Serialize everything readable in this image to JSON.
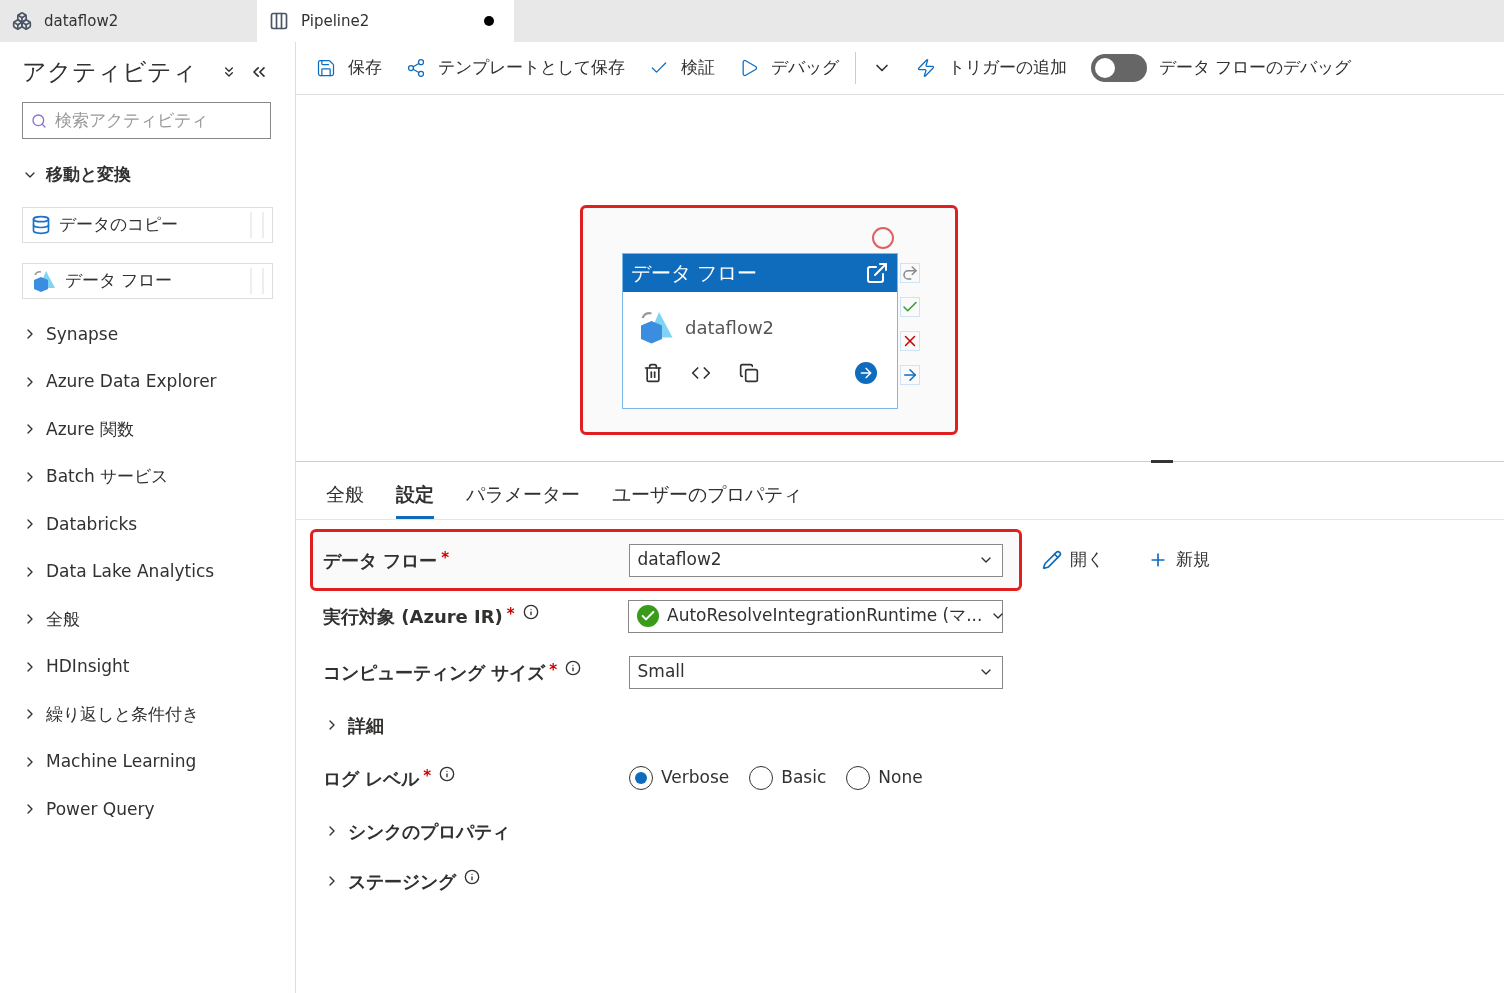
{
  "doc_tabs": [
    {
      "label": "dataflow2",
      "kind": "dataflow",
      "selected": false,
      "modified": false
    },
    {
      "label": "Pipeline2",
      "kind": "pipeline",
      "selected": true,
      "modified": true
    }
  ],
  "sidebar": {
    "title": "アクティビティ",
    "search": {
      "placeholder": "検索アクティビティ"
    },
    "groups": [
      {
        "label": "移動と変換",
        "expanded": true,
        "children": [
          {
            "label": "データのコピー",
            "kind": "copy"
          },
          {
            "label": "データ フロー",
            "kind": "dataflow"
          }
        ]
      },
      {
        "label": "Synapse",
        "expanded": false
      },
      {
        "label": "Azure Data Explorer",
        "expanded": false
      },
      {
        "label": "Azure 関数",
        "expanded": false
      },
      {
        "label": "Batch サービス",
        "expanded": false
      },
      {
        "label": "Databricks",
        "expanded": false
      },
      {
        "label": "Data Lake Analytics",
        "expanded": false
      },
      {
        "label": "全般",
        "expanded": false
      },
      {
        "label": "HDInsight",
        "expanded": false
      },
      {
        "label": "繰り返しと条件付き",
        "expanded": false
      },
      {
        "label": "Machine Learning",
        "expanded": false
      },
      {
        "label": "Power Query",
        "expanded": false
      }
    ]
  },
  "toolbar": {
    "buttons": [
      {
        "label": "保存",
        "kind": "save"
      },
      {
        "label": "テンプレートとして保存",
        "kind": "template"
      },
      {
        "label": "検証",
        "kind": "validate"
      },
      {
        "label": "デバッグ",
        "kind": "debug"
      },
      {
        "label": "トリガーの追加",
        "kind": "trigger"
      }
    ],
    "debug_toggle": {
      "label": "データ フローのデバッグ",
      "on": false
    }
  },
  "activity": {
    "title": "データ フロー",
    "name": "dataflow2",
    "highlighted": true
  },
  "panel_tabs": [
    {
      "label": "全般",
      "selected": false
    },
    {
      "label": "設定",
      "selected": true
    },
    {
      "label": "パラメーター",
      "selected": false
    },
    {
      "label": "ユーザーのプロパティ",
      "selected": false
    }
  ],
  "form": [
    {
      "kind": "dropdown",
      "label": "データ フロー",
      "required_mark": "*",
      "highlighted": true,
      "value": "dataflow2",
      "actions": [
        {
          "label": "開く",
          "kind": "edit"
        },
        {
          "label": "新規",
          "kind": "new"
        }
      ]
    },
    {
      "kind": "dropdown",
      "label": "実行対象 (Azure IR)",
      "required_mark": "*",
      "info": true,
      "value": "AutoResolveIntegrationRuntime (マ...",
      "status_ok": true
    },
    {
      "kind": "dropdown",
      "label": "コンピューティング サイズ",
      "required_mark": "*",
      "info": true,
      "value": "Small"
    },
    {
      "kind": "section",
      "label": "詳細"
    },
    {
      "kind": "radio",
      "label": "ログ レベル",
      "required_mark": "*",
      "info": true,
      "options": [
        {
          "label": "Verbose",
          "selected": true
        },
        {
          "label": "Basic",
          "selected": false
        },
        {
          "label": "None",
          "selected": false
        }
      ]
    },
    {
      "kind": "section",
      "label": "シンクのプロパティ"
    },
    {
      "kind": "section",
      "label": "ステージング",
      "info": true
    }
  ]
}
